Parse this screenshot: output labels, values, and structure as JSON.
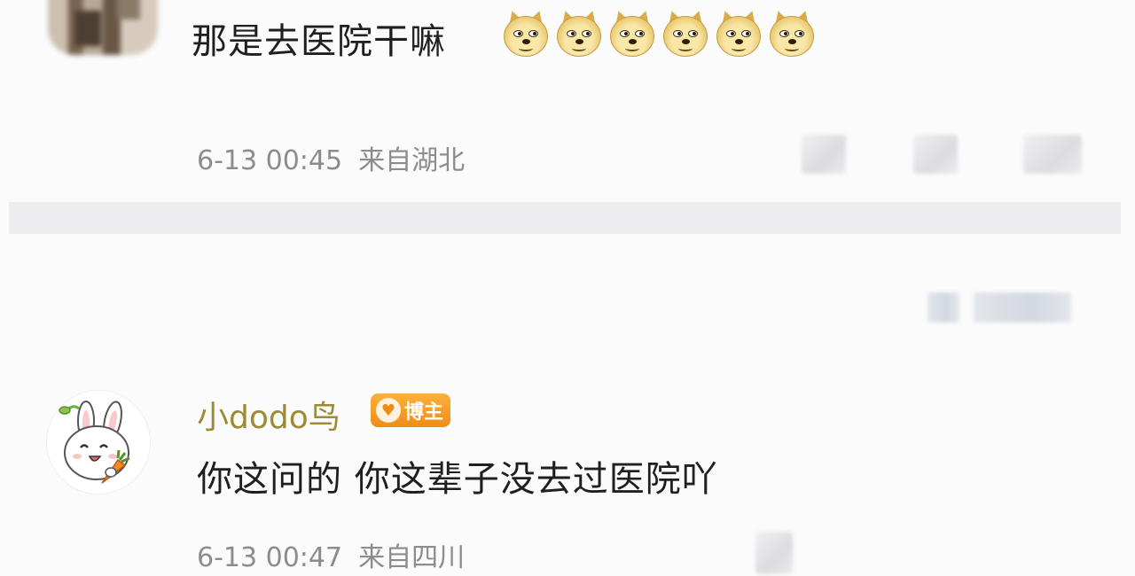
{
  "comments": [
    {
      "text": "那是去医院干嘛",
      "emoji_count": 6,
      "emoji_name": "doge-emoji",
      "time": "6-13 00:45",
      "location": "来自湖北"
    },
    {
      "username": "小dodo鸟",
      "badge": "博主",
      "text": "你这问的 你这辈子没去过医院吖",
      "time": "6-13 00:47",
      "location": "来自四川"
    }
  ],
  "colors": {
    "background": "#fbfbfc",
    "text": "#1f1f1f",
    "meta": "#8c8c8c",
    "username": "#9c8a35",
    "badge": "#f08c16",
    "divider": "#ededf0"
  }
}
